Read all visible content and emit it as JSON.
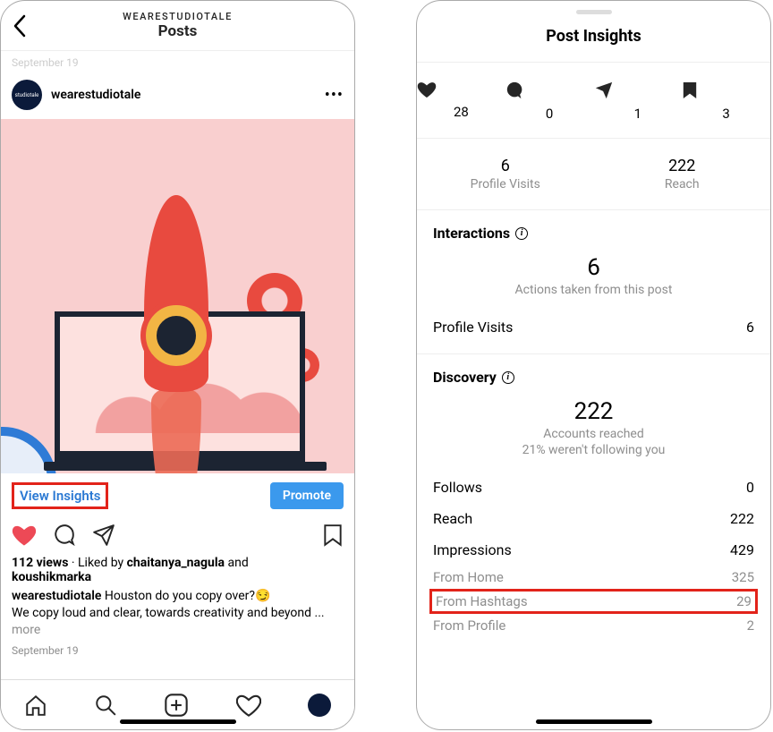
{
  "left": {
    "header": {
      "username_upper": "WEARESTUDIOTALE",
      "title": "Posts"
    },
    "prev_date_faint": "September 19",
    "post": {
      "avatar_text": "studiotale",
      "username": "wearestudiotale",
      "view_insights": "View Insights",
      "promote": "Promote",
      "views_count": "112 views",
      "liked_prefix": " · Liked by ",
      "liker1": "chaitanya_nagula",
      "liked_and": " and ",
      "liker2": "koushikmarka",
      "caption_user": "wearestudiotale",
      "caption_text": " Houston do you copy over?",
      "caption_emoji": "😏",
      "caption_line2": "We copy loud and clear, towards creativity and beyond ... ",
      "more": "more",
      "date": "September 19"
    }
  },
  "right": {
    "title": "Post Insights",
    "metrics": {
      "likes": "28",
      "comments": "0",
      "shares": "1",
      "saves": "3"
    },
    "row2": {
      "profile_visits_num": "6",
      "profile_visits_lbl": "Profile Visits",
      "reach_num": "222",
      "reach_lbl": "Reach"
    },
    "interactions": {
      "heading": "Interactions",
      "big": "6",
      "sub": "Actions taken from this post",
      "profile_visits_lbl": "Profile Visits",
      "profile_visits_val": "6"
    },
    "discovery": {
      "heading": "Discovery",
      "big": "222",
      "sub1": "Accounts reached",
      "sub2": "21% weren't following you",
      "follows_lbl": "Follows",
      "follows_val": "0",
      "reach_lbl": "Reach",
      "reach_val": "222",
      "impr_lbl": "Impressions",
      "impr_val": "429",
      "home_lbl": "From Home",
      "home_val": "325",
      "hash_lbl": "From Hashtags",
      "hash_val": "29",
      "profile_lbl": "From Profile",
      "profile_val": "2"
    }
  }
}
